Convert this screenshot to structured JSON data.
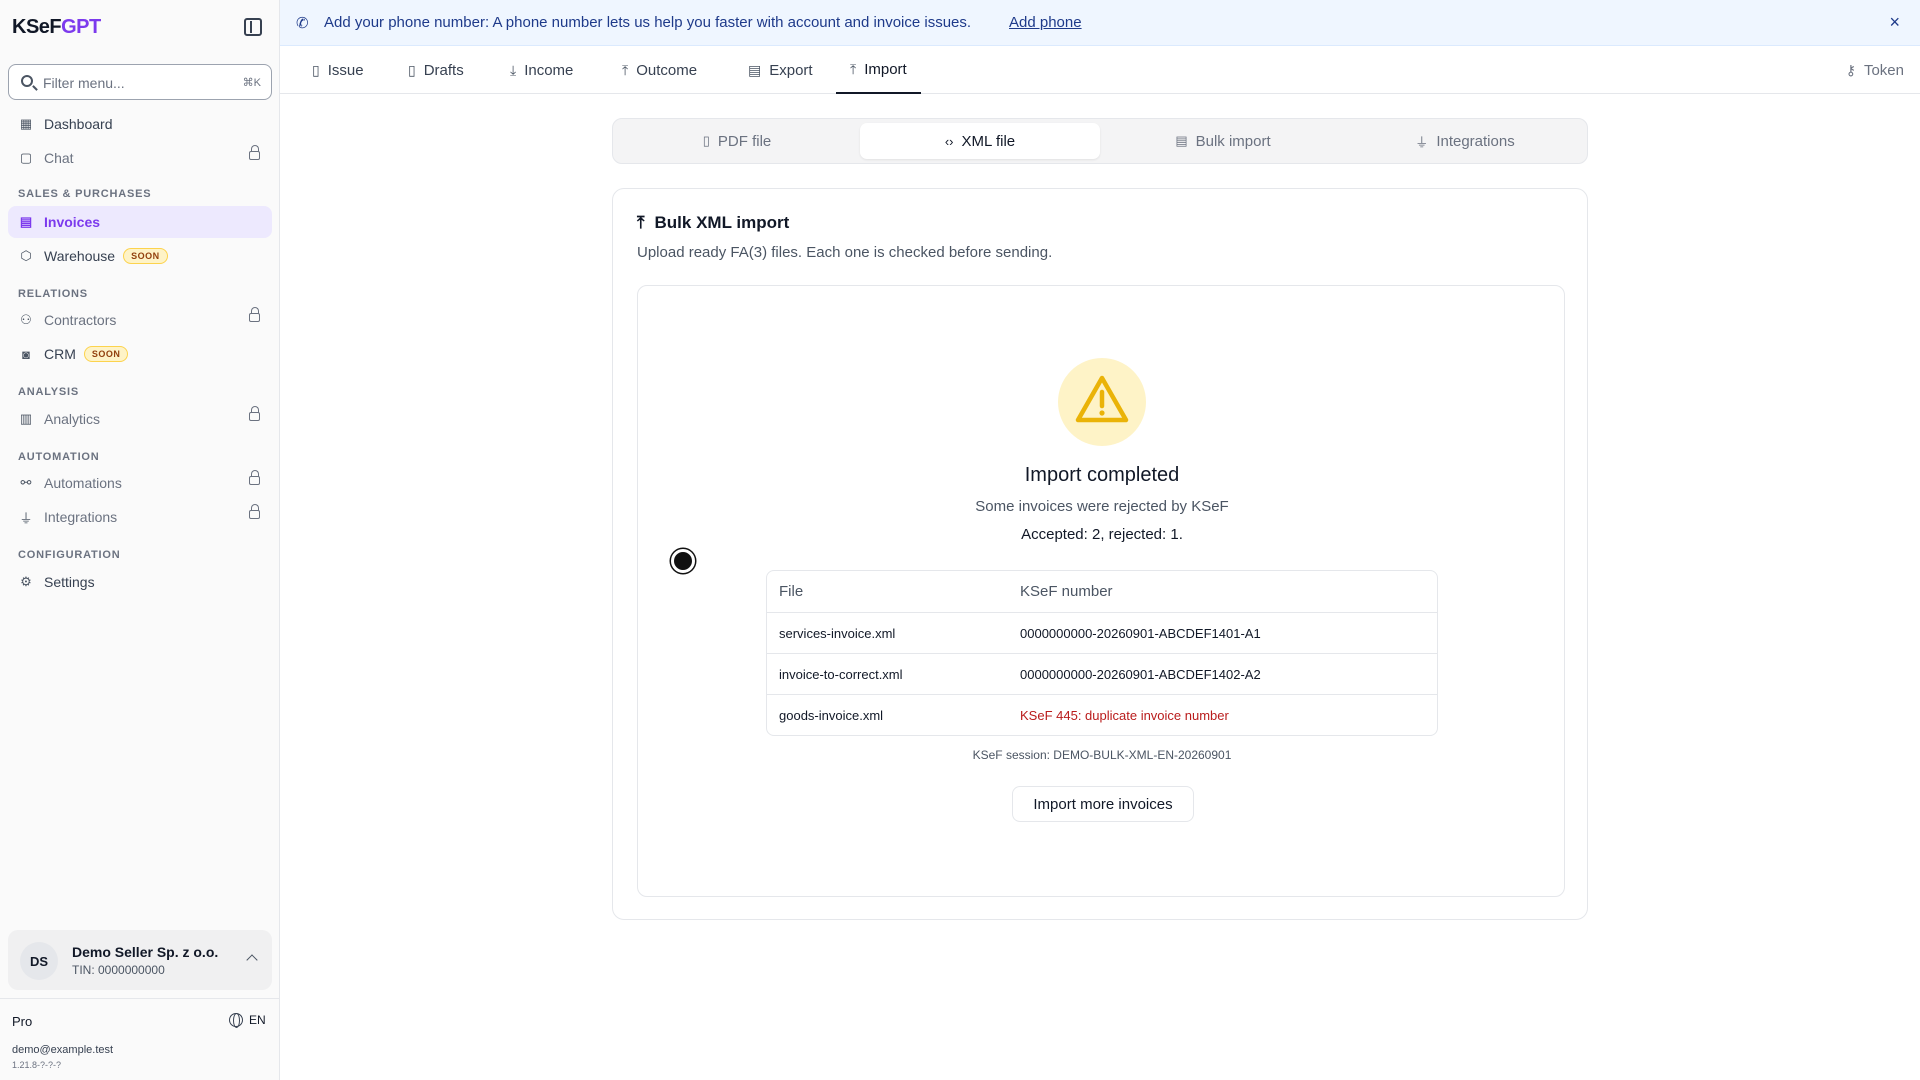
{
  "app": {
    "logo_main": "KSeF",
    "logo_accent": "GPT"
  },
  "sidebar": {
    "filter_placeholder": "Filter menu...",
    "filter_shortcut": "⌘K",
    "items": {
      "dashboard": "Dashboard",
      "chat": "Chat",
      "invoices": "Invoices",
      "warehouse": "Warehouse",
      "contractors": "Contractors",
      "crm": "CRM",
      "analytics": "Analytics",
      "automations": "Automations",
      "integrations": "Integrations",
      "settings": "Settings"
    },
    "soon_badge": "SOON",
    "sections": {
      "sales": "SALES & PURCHASES",
      "relations": "RELATIONS",
      "analysis": "ANALYSIS",
      "automation": "AUTOMATION",
      "configuration": "CONFIGURATION"
    },
    "account": {
      "initials": "DS",
      "name": "Demo Seller Sp. z o.o.",
      "tin": "TIN: 0000000000"
    },
    "plan": "Pro",
    "language": "EN",
    "email": "demo@example.test",
    "version": "1.21.8-?-?-?"
  },
  "banner": {
    "text": "Add your phone number: A phone number lets us help you faster with account and invoice issues.",
    "link": "Add phone",
    "close": "×"
  },
  "tabs": {
    "issue": "Issue",
    "drafts": "Drafts",
    "income": "Income",
    "outcome": "Outcome",
    "export": "Export",
    "import": "Import",
    "token": "Token"
  },
  "subtabs": {
    "pdf": "PDF file",
    "xml": "XML file",
    "bulk": "Bulk import",
    "integrations": "Integrations"
  },
  "card": {
    "title": "Bulk XML import",
    "subtitle": "Upload ready FA(3) files. Each one is checked before sending."
  },
  "result": {
    "title": "Import completed",
    "subtitle": "Some invoices were rejected by KSeF",
    "counts": "Accepted: 2, rejected: 1.",
    "columns": {
      "file": "File",
      "ksef": "KSeF number"
    },
    "rows": [
      {
        "file": "services-invoice.xml",
        "ksef": "0000000000-20260901-ABCDEF1401-A1"
      },
      {
        "file": "invoice-to-correct.xml",
        "ksef": "0000000000-20260901-ABCDEF1402-A2"
      },
      {
        "file": "goods-invoice.xml",
        "ksef": "KSeF 445: duplicate invoice number"
      }
    ],
    "session": "KSeF session: DEMO-BULK-XML-EN-20260901",
    "more_button": "Import more invoices"
  },
  "colors": {
    "accent": "#7c3aed",
    "warning": "#eab308",
    "error": "#b91c1c",
    "banner_bg": "#eff6ff"
  }
}
